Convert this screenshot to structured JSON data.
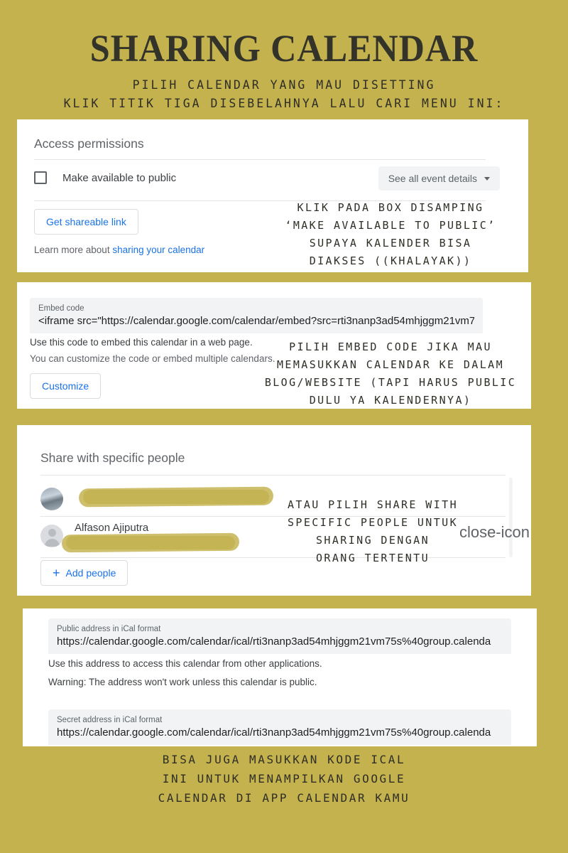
{
  "colors": {
    "background": "#c4b24f",
    "card": "#ffffff",
    "accent_blue": "#1a73e8",
    "text_dark": "#2f2e26",
    "google_grey": "#5f6368"
  },
  "header": {
    "title": "SHARING CALENDAR",
    "subtitle_line1": "PILIH CALENDAR YANG MAU DISETTING",
    "subtitle_line2": "KLIK TITIK TIGA DISEBELAHNYA LALU CARI MENU INI:"
  },
  "card_access": {
    "title": "Access permissions",
    "checkbox_label": "Make available to public",
    "checkbox_checked": false,
    "dropdown_value": "See all event details",
    "dropdown_icon": "chevron-down-icon",
    "shareable_link_button": "Get shareable link",
    "learn_more_prefix": "Learn more about ",
    "learn_more_link": "sharing your calendar",
    "annotation": [
      "KLIK PADA BOX DISAMPING",
      "‘MAKE AVAILABLE TO PUBLIC’",
      "SUPAYA KALENDER BISA",
      "DIAKSES ((KHALAYAK))"
    ]
  },
  "card_embed": {
    "field_label": "Embed code",
    "field_value": "<iframe src=\"https://calendar.google.com/calendar/embed?src=rti3nanp3ad54mhjggm21vm7",
    "help_line1": "Use this code to embed this calendar in a web page.",
    "help_line2": "You can customize the code or embed multiple calendars.",
    "customize_button": "Customize",
    "annotation": [
      "PILIH EMBED CODE JIKA MAU",
      "MEMASUKKAN CALENDAR KE DALAM",
      "BLOG/WEBSITE (TAPI HARUS PUBLIC",
      "DULU YA KALENDERNYA)"
    ]
  },
  "card_share": {
    "title": "Share with specific people",
    "people": [
      {
        "name": "",
        "email": "",
        "avatar": "photo-avatar",
        "redacted": true
      },
      {
        "name": "Alfason Ajiputra",
        "email": "",
        "avatar": "generic-avatar",
        "redacted": true
      }
    ],
    "add_people_button": "Add people",
    "add_icon": "plus-icon",
    "close_icon": "close-icon",
    "annotation": [
      "ATAU PILIH SHARE WITH",
      "SPECIFIC PEOPLE UNTUK",
      "SHARING DENGAN",
      "ORANG TERTENTU"
    ]
  },
  "card_ical": {
    "public_label": "Public address in iCal format",
    "public_value": "https://calendar.google.com/calendar/ical/rti3nanp3ad54mhjggm21vm75s%40group.calenda",
    "help_line1": "Use this address to access this calendar from other applications.",
    "help_line2": "Warning: The address won't work unless this calendar is public.",
    "secret_label": "Secret address in iCal format",
    "secret_value": "https://calendar.google.com/calendar/ical/rti3nanp3ad54mhjggm21vm75s%40group.calenda"
  },
  "footer": {
    "line1": "BISA JUGA MASUKKAN KODE ICAL",
    "line2": "INI UNTUK MENAMPILKAN GOOGLE",
    "line3": "CALENDAR DI APP CALENDAR KAMU"
  }
}
